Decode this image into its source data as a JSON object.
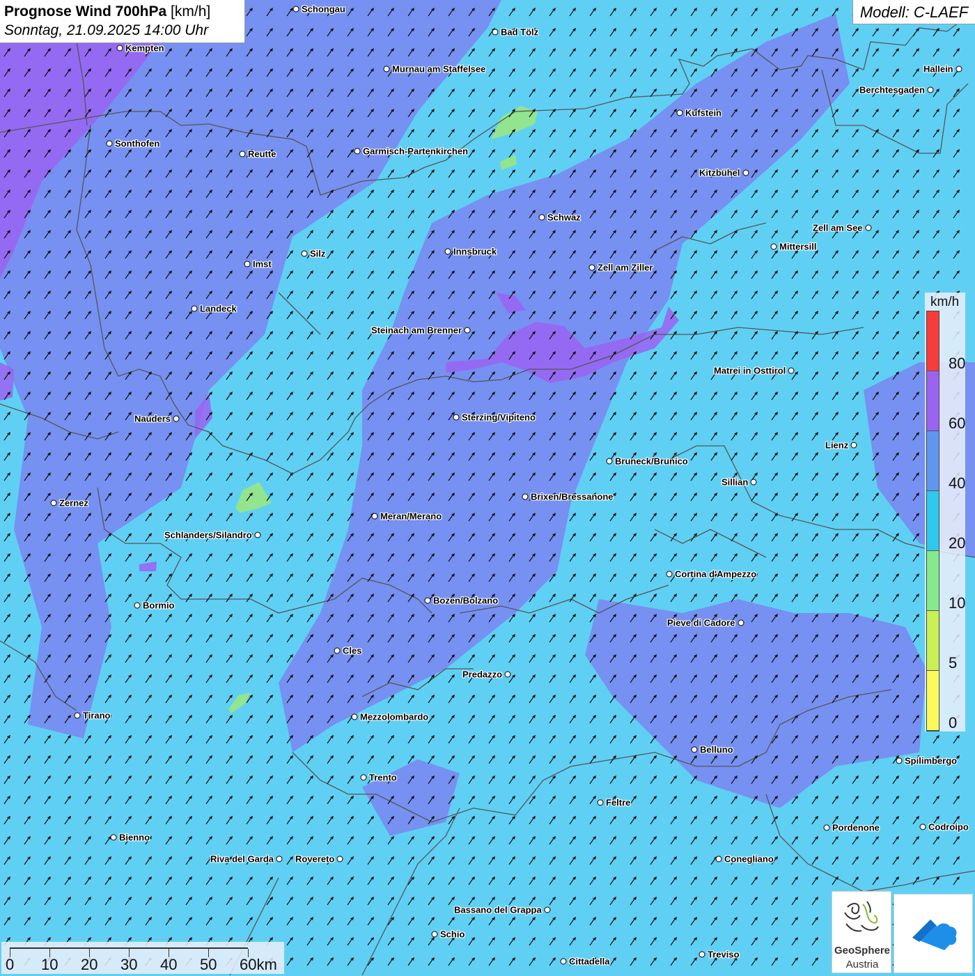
{
  "title": {
    "bold": "Prognose Wind 700hPa",
    "unit": "[km/h]",
    "date": "Sonntag, 21.09.2025 14:00 Uhr"
  },
  "model": "Modell: C-LAEF",
  "legend": {
    "title": "km/h",
    "classes": [
      {
        "label": "80",
        "color": "#f83c3c"
      },
      {
        "label": "60",
        "color": "#9a63f2"
      },
      {
        "label": "40",
        "color": "#5f96f2"
      },
      {
        "label": "20",
        "color": "#2ec9f0"
      },
      {
        "label": "10",
        "color": "#84ea8c"
      },
      {
        "label": "5",
        "color": "#c8f055"
      },
      {
        "label": "0",
        "color": "#fcfa5a"
      }
    ]
  },
  "scale": {
    "labels": [
      "0",
      "10",
      "20",
      "30",
      "40",
      "50",
      "60km"
    ]
  },
  "logos": {
    "geosphere_line1": "GeoSphere",
    "geosphere_line2": "Austria"
  },
  "colors": {
    "base": "#5fd0f4",
    "purple_region": "#7a86f0",
    "violet": "#9a63f2",
    "green": "#9be77c",
    "arrow": "#111111",
    "border": "#555555"
  },
  "cities": [
    {
      "name": "Schongau"
    },
    {
      "name": "Bad Tölz"
    },
    {
      "name": "Kempten"
    },
    {
      "name": "Murnau am Staffelsee"
    },
    {
      "name": "Hallein"
    },
    {
      "name": "Berchtesgaden"
    },
    {
      "name": "Kufstein"
    },
    {
      "name": "Sonthofen"
    },
    {
      "name": "Reutte"
    },
    {
      "name": "Garmisch-Partenkirchen"
    },
    {
      "name": "Kitzbühel"
    },
    {
      "name": "Schwaz"
    },
    {
      "name": "Zell am See"
    },
    {
      "name": "Mittersill"
    },
    {
      "name": "Innsbruck"
    },
    {
      "name": "Silz"
    },
    {
      "name": "Imst"
    },
    {
      "name": "Zell am Ziller"
    },
    {
      "name": "Landeck"
    },
    {
      "name": "Steinach am Brenner"
    },
    {
      "name": "Matrei in Osttirol"
    },
    {
      "name": "Nauders"
    },
    {
      "name": "Sterzing/Vipiteno"
    },
    {
      "name": "Lienz"
    },
    {
      "name": "Bruneck/Brunico"
    },
    {
      "name": "Sillian"
    },
    {
      "name": "Zernez"
    },
    {
      "name": "Brixen/Bressanone"
    },
    {
      "name": "Meran/Merano"
    },
    {
      "name": "Schlanders/Silandro"
    },
    {
      "name": "Cortina d'Ampezzo"
    },
    {
      "name": "Bormio"
    },
    {
      "name": "Bozen/Bolzano"
    },
    {
      "name": "Pieve di Cadore"
    },
    {
      "name": "Cles"
    },
    {
      "name": "Predazzo"
    },
    {
      "name": "Tirano"
    },
    {
      "name": "Mezzolombardo"
    },
    {
      "name": "Belluno"
    },
    {
      "name": "Spilimbergo"
    },
    {
      "name": "Trento"
    },
    {
      "name": "Feltre"
    },
    {
      "name": "Pordenone"
    },
    {
      "name": "Codroipo"
    },
    {
      "name": "Bienno"
    },
    {
      "name": "Riva del Garda"
    },
    {
      "name": "Rovereto"
    },
    {
      "name": "Conegliano"
    },
    {
      "name": "Bassano del Grappa"
    },
    {
      "name": "Schio"
    },
    {
      "name": "Treviso"
    },
    {
      "name": "Cittadella"
    }
  ]
}
